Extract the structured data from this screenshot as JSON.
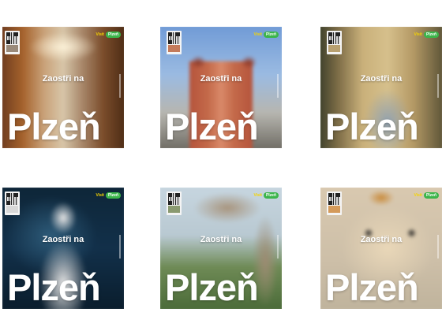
{
  "posters": [
    {
      "tagline": "Zaostři na",
      "city": "Plzeň",
      "visit": "Visit",
      "brand": "Plzeň"
    },
    {
      "tagline": "Zaostři na",
      "city": "Plzeň",
      "visit": "Visit",
      "brand": "Plzeň"
    },
    {
      "tagline": "Zaostři na",
      "city": "Plzeň",
      "visit": "Visit",
      "brand": "Plzeň"
    },
    {
      "tagline": "Zaostři na",
      "city": "Plzeň",
      "visit": "Visit",
      "brand": "Plzeň"
    },
    {
      "tagline": "Zaostři na",
      "city": "Plzeň",
      "visit": "Visit",
      "brand": "Plzeň"
    },
    {
      "tagline": "Zaostři na",
      "city": "Plzeň",
      "visit": "Visit",
      "brand": "Plzeň"
    }
  ],
  "colors": {
    "visit_yellow": "#f5d400",
    "brand_green": "#3bb54a",
    "text": "#ffffff"
  }
}
